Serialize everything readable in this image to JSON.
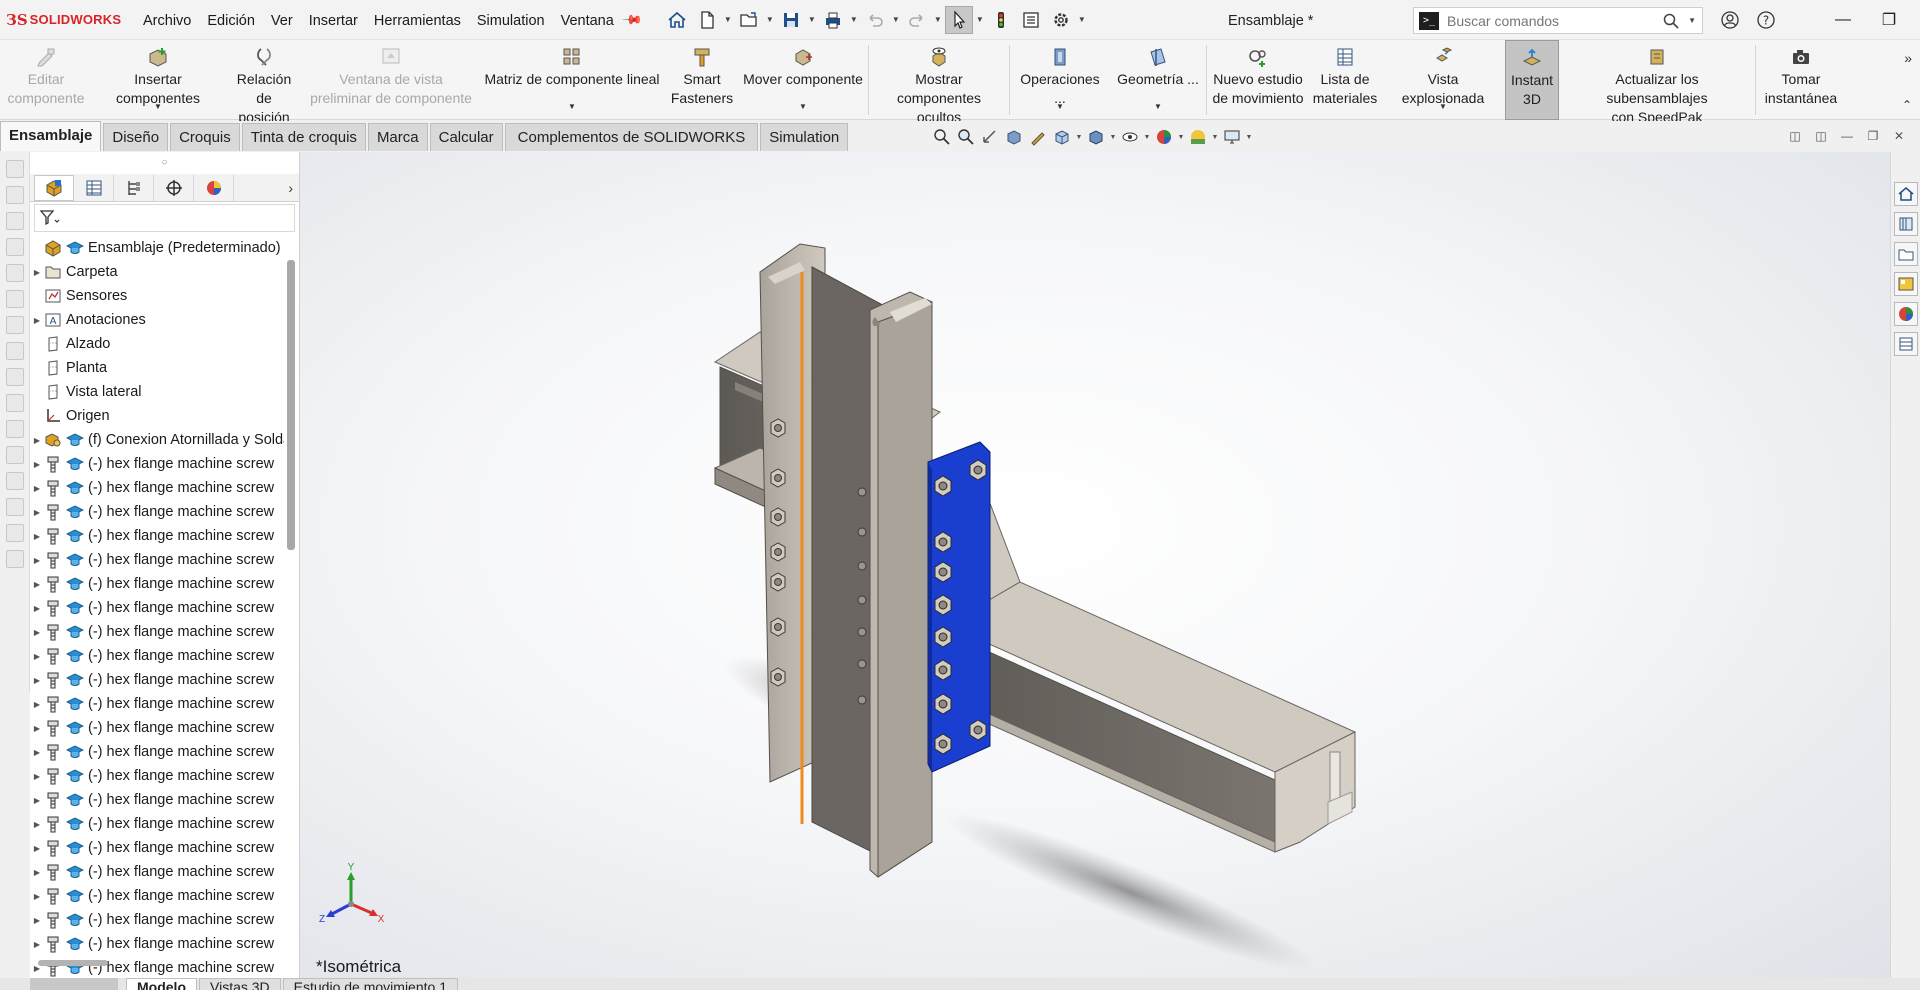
{
  "app": {
    "logo_text": "SOLIDWORKS",
    "document_title": "Ensamblaje *",
    "menu": [
      "Archivo",
      "Edición",
      "Ver",
      "Insertar",
      "Herramientas",
      "Simulation",
      "Ventana"
    ]
  },
  "search": {
    "placeholder": "Buscar comandos"
  },
  "ribbon": {
    "buttons": [
      {
        "label": "Editar\ncomponente",
        "icon": "edit-component-icon",
        "disabled": true
      },
      {
        "label": "Insertar componentes",
        "icon": "insert-components-icon",
        "dropdown": true
      },
      {
        "label": "Relación de\nposición",
        "icon": "mate-icon"
      },
      {
        "label": "Ventana de vista\npreliminar de componente",
        "icon": "preview-window-icon",
        "disabled": true
      },
      {
        "label": "Matriz de componente lineal",
        "icon": "linear-pattern-icon",
        "dropdown": true
      },
      {
        "label": "Smart\nFasteners",
        "icon": "smart-fasteners-icon"
      },
      {
        "label": "Mover componente",
        "icon": "move-component-icon",
        "dropdown": true
      },
      {
        "label": "Mostrar\ncomponentes ocultos",
        "icon": "show-hidden-icon"
      },
      {
        "label": "Operaciones ...",
        "icon": "assembly-features-icon",
        "dropdown": true
      },
      {
        "label": "Geometría ...",
        "icon": "reference-geometry-icon",
        "dropdown": true
      },
      {
        "label": "Nuevo estudio\nde movimiento",
        "icon": "motion-study-icon"
      },
      {
        "label": "Lista de\nmateriales",
        "icon": "bom-icon"
      },
      {
        "label": "Vista explosionada",
        "icon": "exploded-view-icon",
        "dropdown": true
      },
      {
        "label": "Instant\n3D",
        "icon": "instant3d-icon",
        "active": true
      },
      {
        "label": "Actualizar los subensamblajes\ncon SpeedPak",
        "icon": "speedpak-icon"
      },
      {
        "label": "Tomar\ninstantánea",
        "icon": "snapshot-icon"
      }
    ]
  },
  "tabs": [
    "Ensamblaje",
    "Diseño",
    "Croquis",
    "Tinta de croquis",
    "Marca",
    "Calcular",
    "Complementos de SOLIDWORKS",
    "Simulation"
  ],
  "active_tab": "Ensamblaje",
  "tree": {
    "root": "Ensamblaje  (Predeterminado)",
    "items": [
      {
        "label": "Carpeta",
        "icon": "folder-icon",
        "expandable": true
      },
      {
        "label": "Sensores",
        "icon": "sensor-icon",
        "expandable": false
      },
      {
        "label": "Anotaciones",
        "icon": "annotations-icon",
        "expandable": true
      },
      {
        "label": "Alzado",
        "icon": "plane-icon",
        "expandable": false
      },
      {
        "label": "Planta",
        "icon": "plane-icon",
        "expandable": false
      },
      {
        "label": "Vista lateral",
        "icon": "plane-icon",
        "expandable": false
      },
      {
        "label": "Origen",
        "icon": "origin-icon",
        "expandable": false
      },
      {
        "label": "(f) Conexion Atornillada y Soldada",
        "icon": "subassembly-icon",
        "expandable": true
      },
      {
        "label": "(-) hex flange machine screw",
        "icon": "screw-icon",
        "expandable": true
      },
      {
        "label": "(-) hex flange machine screw",
        "icon": "screw-icon",
        "expandable": true
      },
      {
        "label": "(-) hex flange machine screw",
        "icon": "screw-icon",
        "expandable": true
      },
      {
        "label": "(-) hex flange machine screw",
        "icon": "screw-icon",
        "expandable": true
      },
      {
        "label": "(-) hex flange machine screw",
        "icon": "screw-icon",
        "expandable": true
      },
      {
        "label": "(-) hex flange machine screw",
        "icon": "screw-icon",
        "expandable": true
      },
      {
        "label": "(-) hex flange machine screw",
        "icon": "screw-icon",
        "expandable": true
      },
      {
        "label": "(-) hex flange machine screw",
        "icon": "screw-icon",
        "expandable": true
      },
      {
        "label": "(-) hex flange machine screw",
        "icon": "screw-icon",
        "expandable": true
      },
      {
        "label": "(-) hex flange machine screw",
        "icon": "screw-icon",
        "expandable": true
      },
      {
        "label": "(-) hex flange machine screw",
        "icon": "screw-icon",
        "expandable": true
      },
      {
        "label": "(-) hex flange machine screw",
        "icon": "screw-icon",
        "expandable": true
      },
      {
        "label": "(-) hex flange machine screw",
        "icon": "screw-icon",
        "expandable": true
      },
      {
        "label": "(-) hex flange machine screw",
        "icon": "screw-icon",
        "expandable": true
      },
      {
        "label": "(-) hex flange machine screw",
        "icon": "screw-icon",
        "expandable": true
      },
      {
        "label": "(-) hex flange machine screw",
        "icon": "screw-icon",
        "expandable": true
      },
      {
        "label": "(-) hex flange machine screw",
        "icon": "screw-icon",
        "expandable": true
      },
      {
        "label": "(-) hex flange machine screw",
        "icon": "screw-icon",
        "expandable": true
      },
      {
        "label": "(-) hex flange machine screw",
        "icon": "screw-icon",
        "expandable": true
      },
      {
        "label": "(-) hex flange machine screw",
        "icon": "screw-icon",
        "expandable": true
      },
      {
        "label": "(-) hex flange machine screw",
        "icon": "screw-icon",
        "expandable": true
      },
      {
        "label": "(-) hex flange machine screw",
        "icon": "screw-icon",
        "expandable": true
      },
      {
        "label": "(-) hex flange machine screw",
        "icon": "screw-icon",
        "expandable": true
      }
    ]
  },
  "viewport": {
    "view_name": "*Isométrica",
    "triad": {
      "x": "X",
      "y": "Y",
      "z": "Z"
    }
  },
  "bottom_tabs": [
    "Modelo",
    "Vistas 3D",
    "Estudio de movimiento 1"
  ],
  "colors": {
    "brand_red": "#d8232a",
    "plate_blue": "#1a3fd0",
    "weld_orange": "#f08a1c",
    "steel_light": "#bfb9b0",
    "steel_dark": "#6f6a64"
  }
}
